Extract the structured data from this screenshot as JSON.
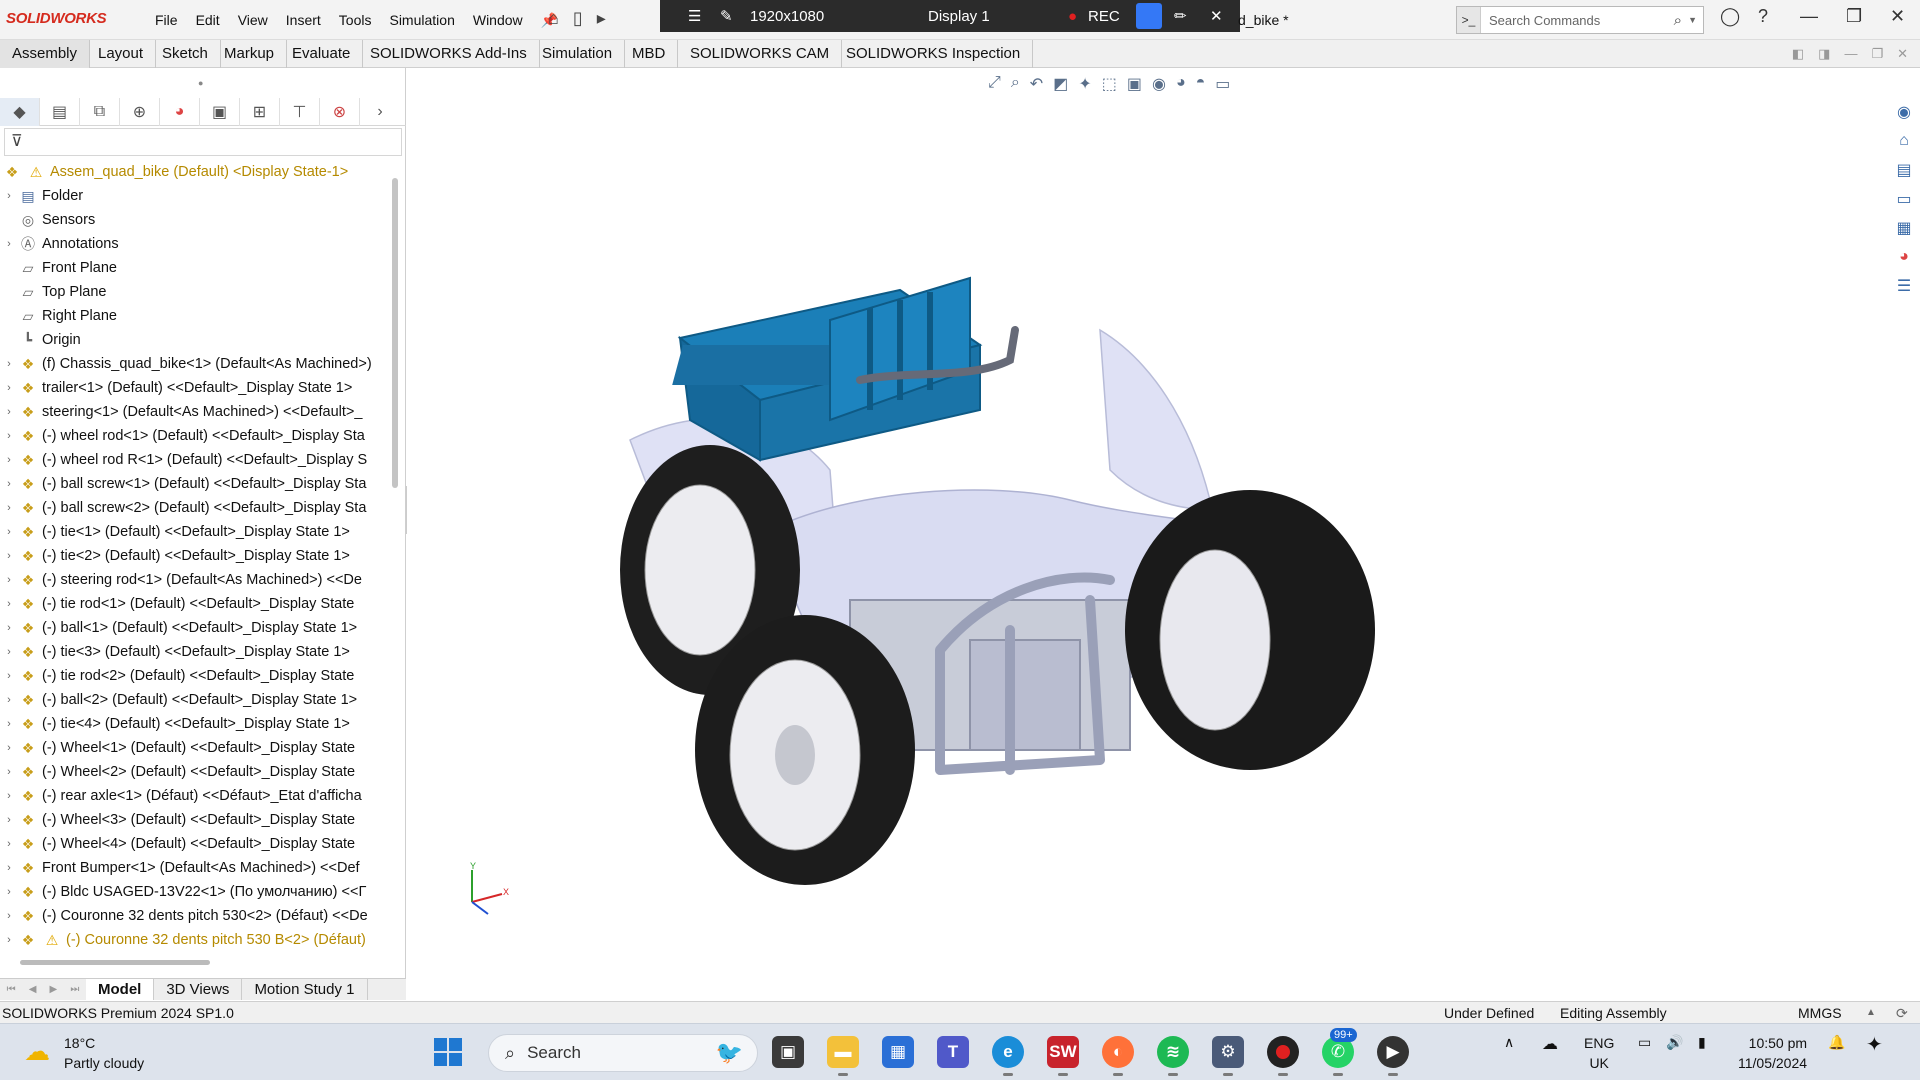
{
  "app": {
    "logo": "SOLIDWORKS",
    "menu": [
      "File",
      "Edit",
      "View",
      "Insert",
      "Tools",
      "Simulation",
      "Window"
    ],
    "doc_title": "d_bike *",
    "search_placeholder": "Search Commands"
  },
  "recorder": {
    "resolution": "1920x1080",
    "display": "Display 1",
    "rec_label": "REC"
  },
  "command_tabs": [
    "Assembly",
    "Layout",
    "Sketch",
    "Markup",
    "Evaluate",
    "SOLIDWORKS Add-Ins",
    "Simulation",
    "MBD",
    "SOLIDWORKS CAM",
    "SOLIDWORKS Inspection"
  ],
  "tree": {
    "root": "Assem_quad_bike (Default) <Display State-1>",
    "items": [
      {
        "label": "Folder",
        "icon": "folder-icon",
        "expand": true
      },
      {
        "label": "Sensors",
        "icon": "sensor-icon",
        "expand": false
      },
      {
        "label": "Annotations",
        "icon": "annotation-icon",
        "expand": true
      },
      {
        "label": "Front Plane",
        "icon": "plane-icon",
        "expand": false
      },
      {
        "label": "Top Plane",
        "icon": "plane-icon",
        "expand": false
      },
      {
        "label": "Right Plane",
        "icon": "plane-icon",
        "expand": false
      },
      {
        "label": "Origin",
        "icon": "origin-icon",
        "expand": false
      },
      {
        "label": "(f) Chassis_quad_bike<1> (Default<As Machined>)",
        "icon": "part-icon",
        "expand": true
      },
      {
        "label": "trailer<1> (Default) <<Default>_Display State 1>",
        "icon": "part-icon",
        "expand": true
      },
      {
        "label": "steering<1> (Default<As Machined>) <<Default>_",
        "icon": "part-icon",
        "expand": true
      },
      {
        "label": "(-) wheel rod<1> (Default) <<Default>_Display Sta",
        "icon": "part-icon",
        "expand": true
      },
      {
        "label": "(-) wheel rod R<1> (Default) <<Default>_Display S",
        "icon": "part-icon",
        "expand": true
      },
      {
        "label": "(-) ball screw<1> (Default) <<Default>_Display Sta",
        "icon": "part-icon",
        "expand": true
      },
      {
        "label": "(-) ball screw<2> (Default) <<Default>_Display Sta",
        "icon": "part-icon",
        "expand": true
      },
      {
        "label": "(-) tie<1> (Default) <<Default>_Display State 1>",
        "icon": "part-icon",
        "expand": true
      },
      {
        "label": "(-) tie<2> (Default) <<Default>_Display State 1>",
        "icon": "part-icon",
        "expand": true
      },
      {
        "label": "(-) steering rod<1> (Default<As Machined>) <<De",
        "icon": "part-icon",
        "expand": true
      },
      {
        "label": "(-) tie rod<1> (Default) <<Default>_Display State",
        "icon": "part-icon",
        "expand": true
      },
      {
        "label": "(-) ball<1> (Default) <<Default>_Display State 1>",
        "icon": "part-icon",
        "expand": true
      },
      {
        "label": "(-) tie<3> (Default) <<Default>_Display State 1>",
        "icon": "part-icon",
        "expand": true
      },
      {
        "label": "(-) tie rod<2> (Default) <<Default>_Display State",
        "icon": "part-icon",
        "expand": true
      },
      {
        "label": "(-) ball<2> (Default) <<Default>_Display State 1>",
        "icon": "part-icon",
        "expand": true
      },
      {
        "label": "(-) tie<4> (Default) <<Default>_Display State 1>",
        "icon": "part-icon",
        "expand": true
      },
      {
        "label": "(-) Wheel<1> (Default) <<Default>_Display State",
        "icon": "part-icon",
        "expand": true
      },
      {
        "label": "(-) Wheel<2> (Default) <<Default>_Display State",
        "icon": "part-icon",
        "expand": true
      },
      {
        "label": "(-) rear axle<1> (Défaut) <<Défaut>_Etat d'afficha",
        "icon": "part-icon",
        "expand": true
      },
      {
        "label": "(-) Wheel<3> (Default) <<Default>_Display State",
        "icon": "part-icon",
        "expand": true
      },
      {
        "label": "(-) Wheel<4> (Default) <<Default>_Display State",
        "icon": "part-icon",
        "expand": true
      },
      {
        "label": "Front Bumper<1> (Default<As Machined>) <<Def",
        "icon": "part-icon",
        "expand": true
      },
      {
        "label": "(-) Bldc USAGED-13V22<1> (По умолчанию) <<Г",
        "icon": "part-icon",
        "expand": true
      },
      {
        "label": "(-) Couronne 32 dents pitch 530<2> (Défaut) <<De",
        "icon": "part-icon",
        "expand": true
      },
      {
        "label": "(-) Couronne 32 dents pitch 530 B<2> (Défaut)",
        "icon": "part-icon",
        "expand": true,
        "warning": true
      }
    ]
  },
  "bottom_tabs": [
    "Model",
    "3D Views",
    "Motion Study 1"
  ],
  "status": {
    "product": "SOLIDWORKS Premium 2024 SP1.0",
    "defined": "Under Defined",
    "mode": "Editing Assembly",
    "units": "MMGS"
  },
  "triad": {
    "y": "Y",
    "x": "X"
  },
  "taskbar": {
    "temp": "18°C",
    "condition": "Partly cloudy",
    "search": "Search",
    "badge": "99+",
    "lang1": "ENG",
    "lang2": "UK",
    "time": "10:50 pm",
    "date": "11/05/2024"
  },
  "colors": {
    "accent": "#1f78d1",
    "trailer": "#1a6fa3",
    "body": "#dcdff5",
    "rec": "#e02020"
  }
}
